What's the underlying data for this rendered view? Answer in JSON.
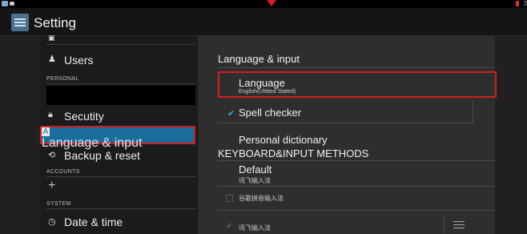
{
  "statusbar": {
    "time": "3"
  },
  "app": {
    "title": "Setting"
  },
  "sidebar": {
    "users": "Users",
    "personal_header": "PERSONAL",
    "security": "Secutity",
    "language_input": "Language & input",
    "backup_reset": "Backup & reset",
    "accounts_header": "ACCOUNTS",
    "add_account": "+",
    "system_header": "SYSTEM",
    "date_time": "Date & time"
  },
  "detail": {
    "title": "Language & input",
    "language_label": "Language",
    "language_value": "English(UNited Stated)",
    "spell_checker": "Spell checker",
    "personal_dictionary": "Personal dictionary",
    "keyboard_header": "KEYBOARD&INPUT METHODS",
    "default_label": "Default",
    "default_value": "讯飞输入法",
    "ime_google": "谷歌拼音输入法",
    "ime_xunfei": "讯飞输入法"
  },
  "colors": {
    "accent_blue": "#1a6e9b",
    "highlight_red": "#d21e1e",
    "check_blue": "#38a7e6"
  }
}
